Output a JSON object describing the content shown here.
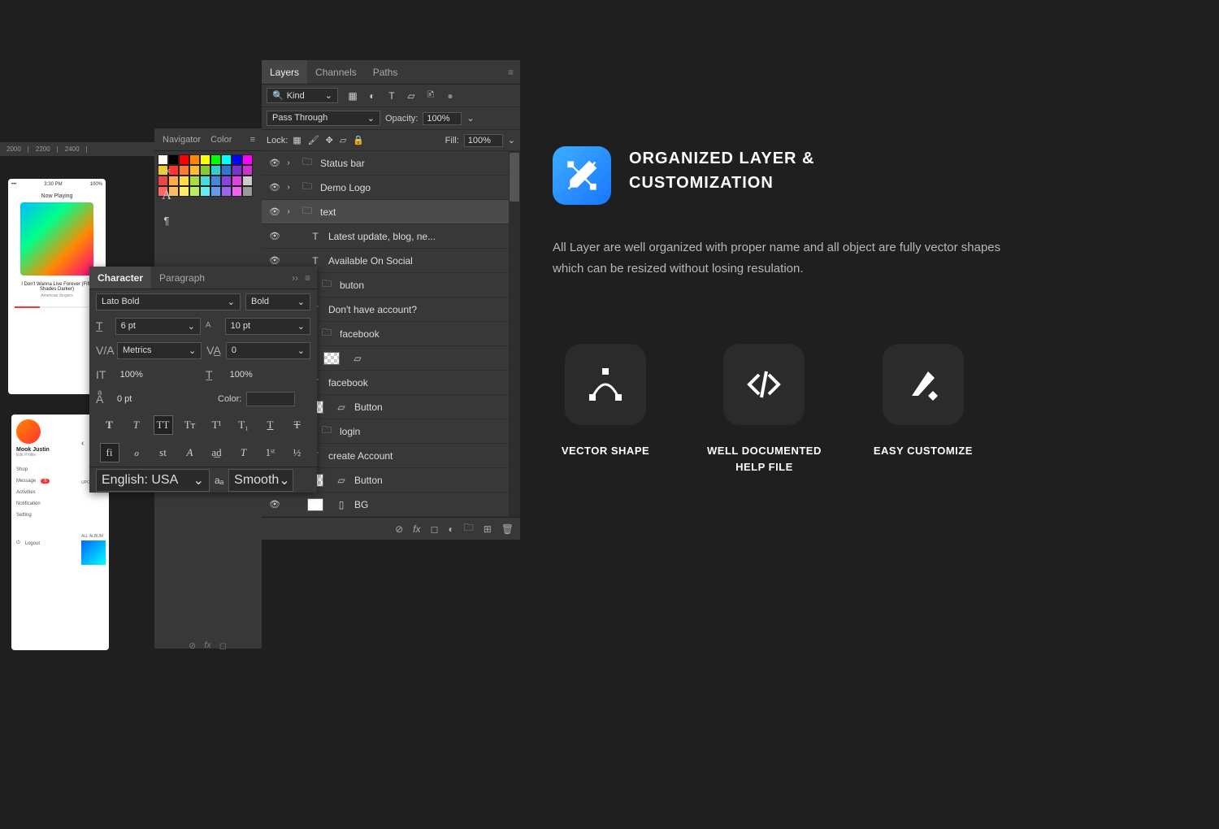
{
  "ruler": {
    "t1": "2000",
    "t2": "2200",
    "t3": "2400"
  },
  "phone1": {
    "status_time": "3:30 PM",
    "now": "Now Playing",
    "song": "I Don't Wanna Live Forever (Fifty Shades Darker)",
    "artist": "American Singers"
  },
  "phone2": {
    "name": "Mook Justin",
    "sub": "Edit Profile",
    "m1": "Shop",
    "m2": "Message",
    "m3": "Activities",
    "m4": "Notification",
    "m5": "Setting",
    "m6": "Logout",
    "upc": "UPC",
    "album": "ALL ALBUM",
    "back": "‹"
  },
  "side": {
    "tab1": "Navigator",
    "tab2": "Color",
    "a": "A",
    "para": "¶"
  },
  "layers": {
    "tab1": "Layers",
    "tab2": "Channels",
    "tab3": "Paths",
    "kind": "Kind",
    "blend": "Pass Through",
    "opacity_label": "Opacity:",
    "opacity": "100%",
    "lock_label": "Lock:",
    "fill_label": "Fill:",
    "fill": "100%",
    "items": [
      {
        "name": "Status bar",
        "type": "folder"
      },
      {
        "name": "Demo Logo",
        "type": "folder"
      },
      {
        "name": "text",
        "type": "folder",
        "sel": true
      },
      {
        "name": "Latest update, blog, ne...",
        "type": "text",
        "indent": 1
      },
      {
        "name": "Available On Social",
        "type": "text",
        "indent": 1
      },
      {
        "name": "buton",
        "type": "folder",
        "indent": 1
      },
      {
        "name": "Don't have account?",
        "type": "text",
        "indent": 1
      },
      {
        "name": "facebook",
        "type": "folder",
        "indent": 1
      },
      {
        "name": "",
        "type": "shape",
        "indent": 2
      },
      {
        "name": "facebook",
        "type": "text",
        "indent": 1
      },
      {
        "name": "Button",
        "type": "shape",
        "indent": 1
      },
      {
        "name": "login",
        "type": "folder",
        "indent": 1
      },
      {
        "name": "create Account",
        "type": "text",
        "indent": 1
      },
      {
        "name": "Button",
        "type": "shape",
        "indent": 1
      },
      {
        "name": "BG",
        "type": "bg",
        "indent": 1
      }
    ]
  },
  "char": {
    "tab1": "Character",
    "tab2": "Paragraph",
    "font": "Lato Bold",
    "weight": "Bold",
    "size": "6 pt",
    "leading": "10 pt",
    "kerning": "Metrics",
    "tracking": "0",
    "vscale": "100%",
    "hscale": "100%",
    "baseline": "0 pt",
    "color_label": "Color:",
    "lang": "English: USA",
    "aa": "Smooth"
  },
  "hero": {
    "title1": "ORGANIZED LAYER &",
    "title2": "CUSTOMIZATION",
    "desc": "All Layer are well organized with proper name and all object are fully vector shapes which can be resized without losing resulation."
  },
  "features": {
    "f1": "VECTOR SHAPE",
    "f2a": "WELL DOCUMENTED",
    "f2b": "HELP FILE",
    "f3": "EASY CUSTOMIZE"
  },
  "swatches": [
    "#fff",
    "#000",
    "#f00",
    "#f80",
    "#ff0",
    "#0f0",
    "#0ff",
    "#00f",
    "#f0f",
    "#ec2",
    "#f33",
    "#f73",
    "#fb3",
    "#8c3",
    "#3cc",
    "#37c",
    "#73c",
    "#c3c",
    "#e44",
    "#fa4",
    "#fd4",
    "#ad4",
    "#4dd",
    "#48d",
    "#84d",
    "#d4d",
    "#ccc",
    "#f66",
    "#fb6",
    "#fe6",
    "#be6",
    "#6ee",
    "#69e",
    "#96e",
    "#e6e",
    "#999"
  ]
}
